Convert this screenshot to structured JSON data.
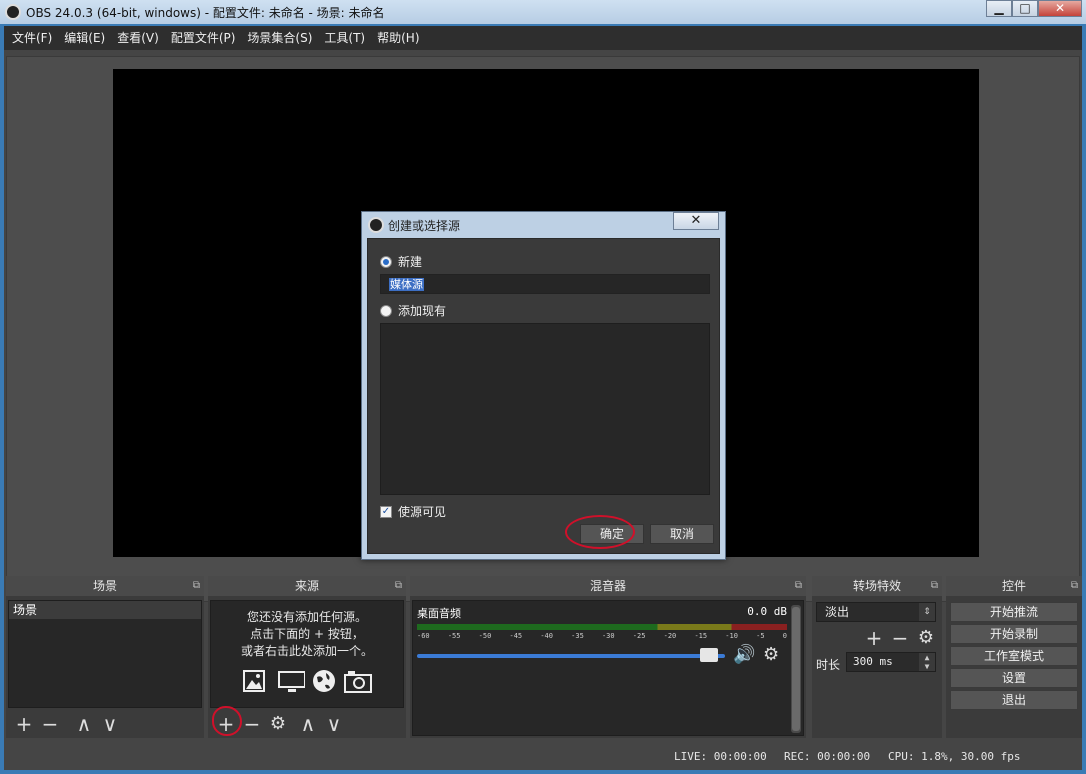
{
  "window": {
    "title": "OBS 24.0.3 (64-bit, windows) - 配置文件: 未命名 - 场景: 未命名",
    "minimize_glyph": "▁",
    "maximize_glyph": "□",
    "close_glyph": "✕"
  },
  "menu": [
    "文件(F)",
    "编辑(E)",
    "查看(V)",
    "配置文件(P)",
    "场景集合(S)",
    "工具(T)",
    "帮助(H)"
  ],
  "docks": {
    "scenes": {
      "title": "场景",
      "items": [
        "场景"
      ]
    },
    "sources": {
      "title": "来源",
      "empty_line1": "您还没有添加任何源。",
      "empty_line2": "点击下面的 + 按钮，",
      "empty_line3": "或者右击此处添加一个。"
    },
    "mixer": {
      "title": "混音器",
      "track_name": "桌面音频",
      "db": "0.0 dB",
      "ticks": [
        "-60",
        "-55",
        "-50",
        "-45",
        "-40",
        "-35",
        "-30",
        "-25",
        "-20",
        "-15",
        "-10",
        "-5",
        "0"
      ],
      "volume_level": 0.95
    },
    "transitions": {
      "title": "转场特效",
      "selected": "淡出",
      "duration_label": "时长",
      "duration_value": "300 ms"
    },
    "controls": {
      "title": "控件",
      "buttons": [
        "开始推流",
        "开始录制",
        "工作室模式",
        "设置",
        "退出"
      ]
    }
  },
  "status": {
    "live": "LIVE: 00:00:00",
    "rec": "REC: 00:00:00",
    "cpu": "CPU: 1.8%, 30.00 fps"
  },
  "dialog": {
    "title": "创建或选择源",
    "close_glyph": "✕",
    "new_label": "新建",
    "name_value": "媒体源",
    "add_existing_label": "添加现有",
    "visible_label": "使源可见",
    "ok_label": "确定",
    "cancel_label": "取消"
  },
  "icons": {
    "add": "+",
    "remove": "−",
    "up": "∧",
    "down": "∨",
    "gear": "⚙",
    "speaker": "🔊",
    "float": "⧉",
    "check": "✓"
  },
  "colors": {
    "accent": "#3d6fc4",
    "annotation": "#d0102a"
  }
}
